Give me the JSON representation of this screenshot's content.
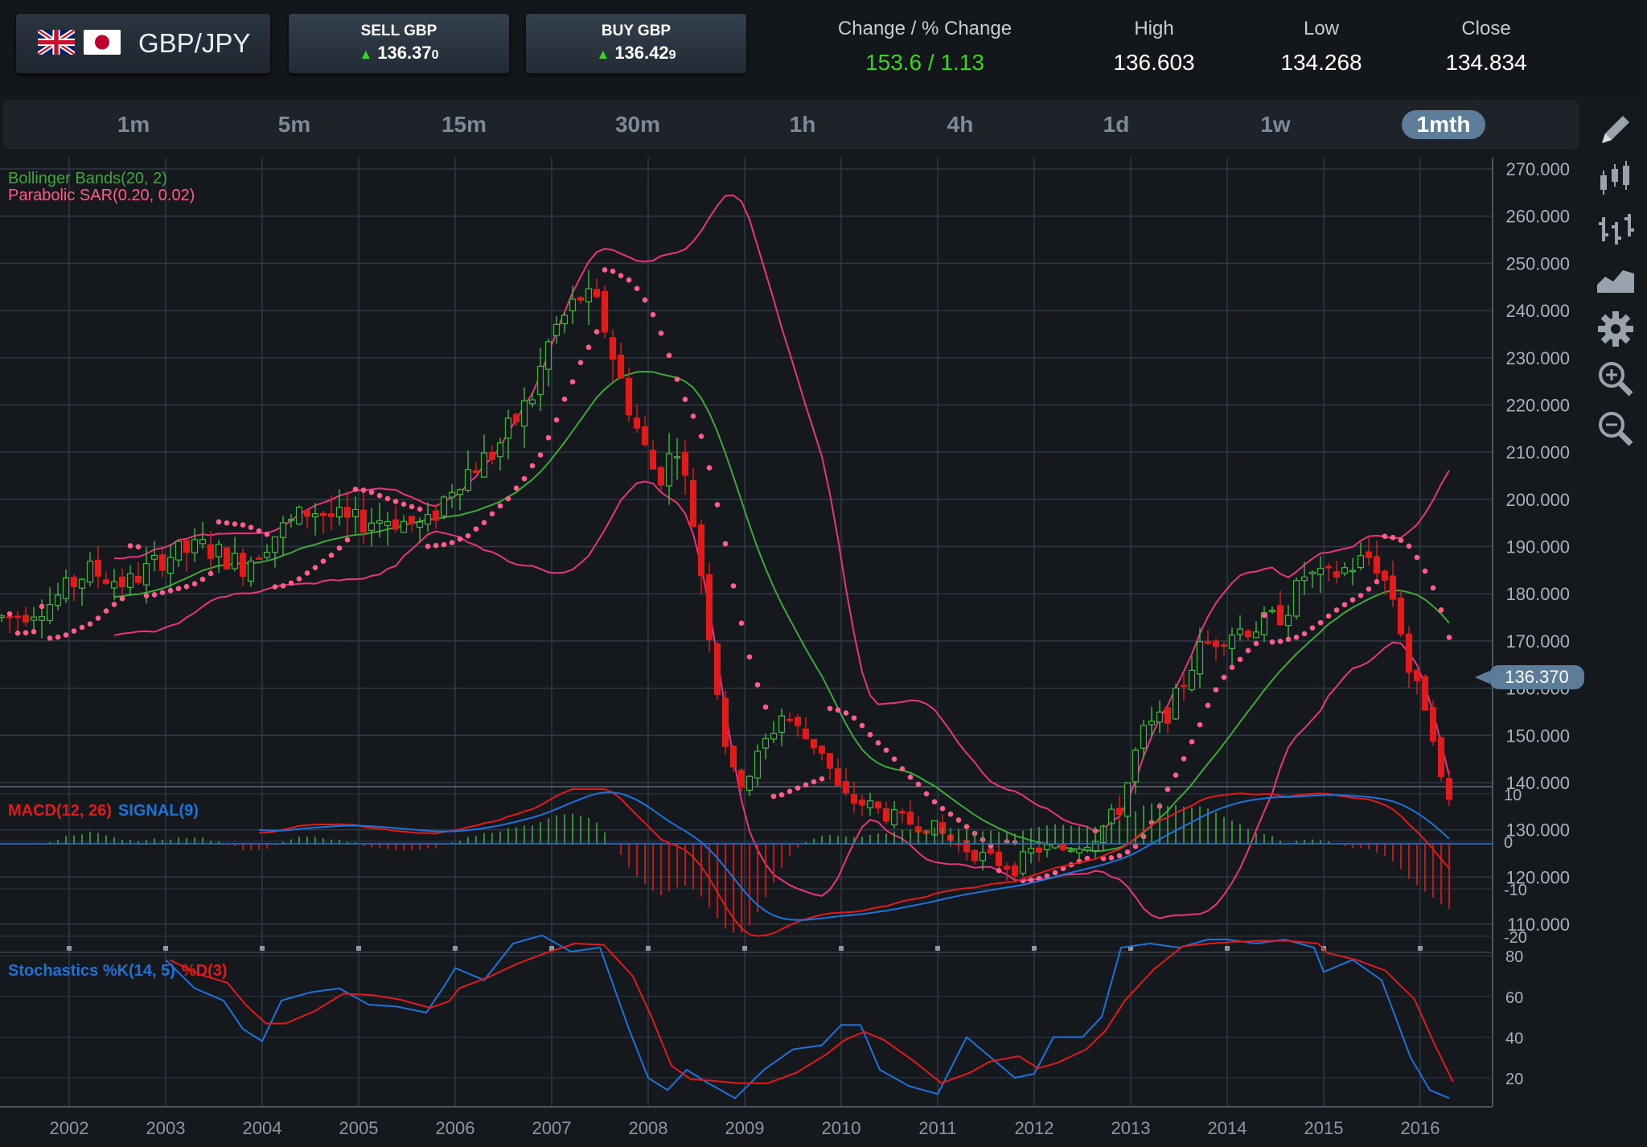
{
  "header": {
    "pair": "GBP/JPY",
    "flags": [
      "uk-flag-icon",
      "japan-flag-icon"
    ],
    "sell": {
      "label": "SELL GBP",
      "price_main": "136.37",
      "price_small": "0"
    },
    "buy": {
      "label": "BUY GBP",
      "price_main": "136.42",
      "price_small": "9"
    },
    "change": {
      "label": "Change / % Change",
      "value": "153.6 / 1.13"
    },
    "high": {
      "label": "High",
      "value": "136.603"
    },
    "low": {
      "label": "Low",
      "value": "134.268"
    },
    "close": {
      "label": "Close",
      "value": "134.834"
    }
  },
  "timeframes": [
    "1m",
    "5m",
    "15m",
    "30m",
    "1h",
    "4h",
    "1d",
    "1w",
    "1mth"
  ],
  "active_timeframe": "1mth",
  "toolbar": [
    "pencil-icon",
    "candlestick-icon",
    "ohlc-bars-icon",
    "area-chart-icon",
    "gear-icon",
    "zoom-in-icon",
    "zoom-out-icon"
  ],
  "colors": {
    "up": "#3fb83a",
    "down": "#e11b1b",
    "sar": "#ff5d8a",
    "bb_outer": "#e8357e",
    "bb_mid": "#3fa83a",
    "macd": "#e11b1b",
    "signal": "#1e73d9",
    "hist_pos": "#3fa83a",
    "hist_neg": "#e11b1b"
  },
  "current_price": "136.370",
  "chart_data": {
    "type": "candlestick",
    "indicators": {
      "bollinger": "Bollinger Bands(20, 2)",
      "sar": "Parabolic SAR(0.20, 0.02)"
    },
    "x_ticks": [
      "2002",
      "2003",
      "2004",
      "2005",
      "2006",
      "2007",
      "2008",
      "2009",
      "2010",
      "2011",
      "2012",
      "2013",
      "2014",
      "2015",
      "2016"
    ],
    "y_ticks": [
      "270.000",
      "260.000",
      "250.000",
      "240.000",
      "230.000",
      "220.000",
      "210.000",
      "200.000",
      "190.000",
      "180.000",
      "170.000",
      "160.000",
      "150.000",
      "140.000",
      "130.000",
      "120.000",
      "110.000"
    ],
    "ylim": [
      110,
      270
    ],
    "anchors": [
      [
        2001.4,
        175
      ],
      [
        2001.8,
        178
      ],
      [
        2002.2,
        185
      ],
      [
        2002.6,
        182
      ],
      [
        2003.0,
        188
      ],
      [
        2003.4,
        190
      ],
      [
        2003.8,
        186
      ],
      [
        2004.1,
        192
      ],
      [
        2004.5,
        198
      ],
      [
        2004.9,
        195
      ],
      [
        2005.3,
        196
      ],
      [
        2005.7,
        194
      ],
      [
        2006.0,
        204
      ],
      [
        2006.4,
        210
      ],
      [
        2006.8,
        222
      ],
      [
        2007.0,
        235
      ],
      [
        2007.3,
        243
      ],
      [
        2007.5,
        240
      ],
      [
        2007.7,
        226
      ],
      [
        2007.9,
        214
      ],
      [
        2008.1,
        204
      ],
      [
        2008.3,
        212
      ],
      [
        2008.5,
        192
      ],
      [
        2008.7,
        162
      ],
      [
        2008.85,
        142
      ],
      [
        2009.0,
        140
      ],
      [
        2009.2,
        148
      ],
      [
        2009.4,
        155
      ],
      [
        2009.6,
        150
      ],
      [
        2009.8,
        147
      ],
      [
        2010.0,
        137
      ],
      [
        2010.3,
        135
      ],
      [
        2010.6,
        132
      ],
      [
        2010.9,
        131
      ],
      [
        2011.2,
        127
      ],
      [
        2011.5,
        124
      ],
      [
        2011.8,
        122
      ],
      [
        2012.0,
        126
      ],
      [
        2012.3,
        126
      ],
      [
        2012.6,
        128
      ],
      [
        2012.9,
        135
      ],
      [
        2013.1,
        150
      ],
      [
        2013.4,
        155
      ],
      [
        2013.7,
        168
      ],
      [
        2014.0,
        172
      ],
      [
        2014.3,
        173
      ],
      [
        2014.6,
        176
      ],
      [
        2014.8,
        184
      ],
      [
        2015.0,
        183
      ],
      [
        2015.3,
        186
      ],
      [
        2015.5,
        188
      ],
      [
        2015.75,
        178
      ],
      [
        2015.9,
        162
      ],
      [
        2016.1,
        155
      ],
      [
        2016.25,
        136
      ]
    ],
    "macd": {
      "label_main": "MACD(12, 26)",
      "label_signal": "SIGNAL(9)",
      "ylim": [
        -22,
        12
      ],
      "y_ticks": [
        "10",
        "0",
        "-10",
        "-20"
      ]
    },
    "stochastics": {
      "label_main": "Stochastics %K(14, 5)",
      "label_d": "%D(3)",
      "ylim": [
        8,
        100
      ],
      "y_ticks": [
        "80",
        "60",
        "40",
        "20"
      ],
      "k": [
        [
          2003.0,
          78
        ],
        [
          2003.3,
          64
        ],
        [
          2003.6,
          58
        ],
        [
          2003.8,
          44
        ],
        [
          2004.0,
          38
        ],
        [
          2004.2,
          58
        ],
        [
          2004.5,
          62
        ],
        [
          2004.8,
          64
        ],
        [
          2005.1,
          56
        ],
        [
          2005.4,
          55
        ],
        [
          2005.7,
          52
        ],
        [
          2005.9,
          66
        ],
        [
          2006.0,
          74
        ],
        [
          2006.3,
          68
        ],
        [
          2006.6,
          86
        ],
        [
          2006.9,
          90
        ],
        [
          2007.2,
          82
        ],
        [
          2007.5,
          84
        ],
        [
          2007.8,
          44
        ],
        [
          2008.0,
          20
        ],
        [
          2008.2,
          14
        ],
        [
          2008.4,
          24
        ],
        [
          2008.6,
          18
        ],
        [
          2008.9,
          10
        ],
        [
          2009.2,
          24
        ],
        [
          2009.5,
          34
        ],
        [
          2009.8,
          36
        ],
        [
          2010.0,
          46
        ],
        [
          2010.2,
          46
        ],
        [
          2010.4,
          24
        ],
        [
          2010.7,
          16
        ],
        [
          2011.0,
          12
        ],
        [
          2011.3,
          40
        ],
        [
          2011.5,
          32
        ],
        [
          2011.8,
          20
        ],
        [
          2012.0,
          22
        ],
        [
          2012.2,
          40
        ],
        [
          2012.5,
          40
        ],
        [
          2012.7,
          50
        ],
        [
          2012.9,
          84
        ],
        [
          2013.2,
          86
        ],
        [
          2013.5,
          84
        ],
        [
          2013.8,
          88
        ],
        [
          2014.0,
          88
        ],
        [
          2014.3,
          86
        ],
        [
          2014.6,
          88
        ],
        [
          2014.9,
          84
        ],
        [
          2015.0,
          72
        ],
        [
          2015.3,
          78
        ],
        [
          2015.6,
          68
        ],
        [
          2015.9,
          30
        ],
        [
          2016.1,
          14
        ],
        [
          2016.3,
          10
        ]
      ]
    }
  }
}
